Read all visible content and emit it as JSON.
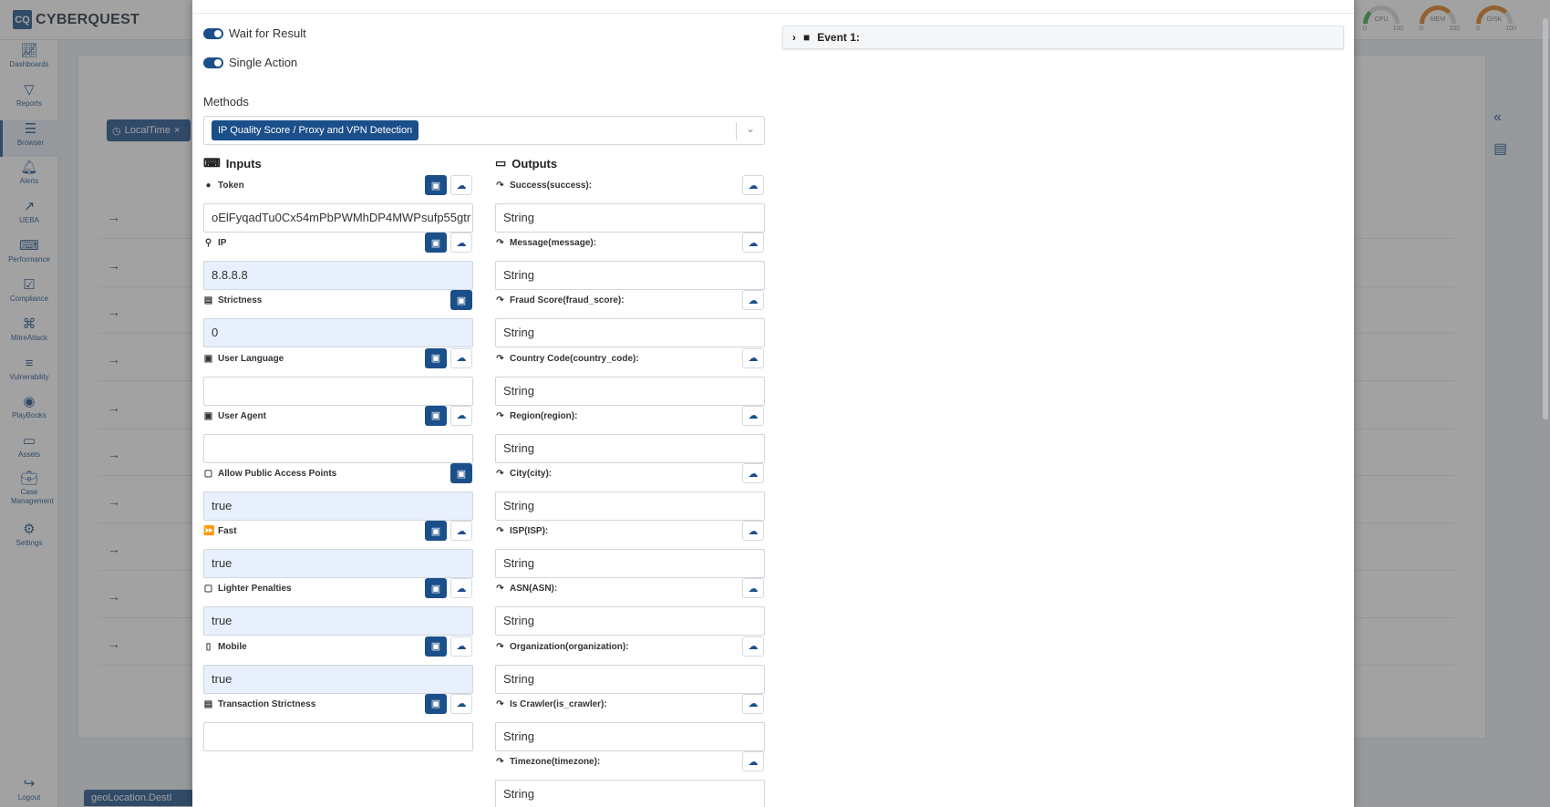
{
  "app": {
    "logo_mark": "CQ",
    "logo_text": "CYBERQUEST"
  },
  "gauges": [
    {
      "label": "CPU",
      "min": "0",
      "max": "100"
    },
    {
      "label": "MEM",
      "min": "0",
      "max": "100"
    },
    {
      "label": "DISK",
      "min": "0",
      "max": "100"
    }
  ],
  "sidebar": {
    "items": [
      {
        "label": "Dashboards",
        "icon": "chart-icon"
      },
      {
        "label": "Reports",
        "icon": "filter-icon"
      },
      {
        "label": "Browser",
        "icon": "list-icon"
      },
      {
        "label": "Alerts",
        "icon": "bell-icon"
      },
      {
        "label": "UEBA",
        "icon": "trend-icon"
      },
      {
        "label": "Performance",
        "icon": "keyboard-icon"
      },
      {
        "label": "Compliance",
        "icon": "compliance-icon"
      },
      {
        "label": "MitreAttack",
        "icon": "command-icon"
      },
      {
        "label": "Vulnerability",
        "icon": "server-icon"
      },
      {
        "label": "PlayBooks",
        "icon": "play-icon"
      },
      {
        "label": "Assets",
        "icon": "laptop-icon"
      },
      {
        "label": "Case Management",
        "icon": "briefcase-icon"
      },
      {
        "label": "Settings",
        "icon": "gear-icon"
      }
    ],
    "logout": "Logout"
  },
  "background": {
    "chip_label": "LocalTime",
    "footer_chip": "geoLocation.DestI"
  },
  "modal": {
    "toggles": [
      {
        "label": "Wait for Result",
        "on": true
      },
      {
        "label": "Single Action",
        "on": true
      }
    ],
    "methods_label": "Methods",
    "method_tag": "IP Quality Score / Proxy and VPN Detection",
    "inputs_title": "Inputs",
    "outputs_title": "Outputs",
    "inputs": [
      {
        "label": "Token",
        "value": "oElFyqadTu0Cx54mPbPWMhDP4MWPsufp55gtr",
        "filled": false,
        "cloud": true
      },
      {
        "label": "IP",
        "value": "8.8.8.8",
        "filled": true,
        "cloud": true
      },
      {
        "label": "Strictness",
        "value": "0",
        "filled": true,
        "cloud": false
      },
      {
        "label": "User Language",
        "value": "",
        "filled": false,
        "cloud": true
      },
      {
        "label": "User Agent",
        "value": "",
        "filled": false,
        "cloud": true
      },
      {
        "label": "Allow Public Access Points",
        "value": "true",
        "filled": true,
        "cloud": false
      },
      {
        "label": "Fast",
        "value": "true",
        "filled": true,
        "cloud": true
      },
      {
        "label": "Lighter Penalties",
        "value": "true",
        "filled": true,
        "cloud": true
      },
      {
        "label": "Mobile",
        "value": "true",
        "filled": true,
        "cloud": true
      },
      {
        "label": "Transaction Strictness",
        "value": "",
        "filled": false,
        "cloud": true
      }
    ],
    "outputs": [
      {
        "label": "Success(success):",
        "value": "String"
      },
      {
        "label": "Message(message):",
        "value": "String"
      },
      {
        "label": "Fraud Score(fraud_score):",
        "value": "String"
      },
      {
        "label": "Country Code(country_code):",
        "value": "String"
      },
      {
        "label": "Region(region):",
        "value": "String"
      },
      {
        "label": "City(city):",
        "value": "String"
      },
      {
        "label": "ISP(ISP):",
        "value": "String"
      },
      {
        "label": "ASN(ASN):",
        "value": "String"
      },
      {
        "label": "Organization(organization):",
        "value": "String"
      },
      {
        "label": "Is Crawler(is_crawler):",
        "value": "String"
      },
      {
        "label": "Timezone(timezone):",
        "value": "String"
      }
    ],
    "event_title": "Event 1:"
  }
}
